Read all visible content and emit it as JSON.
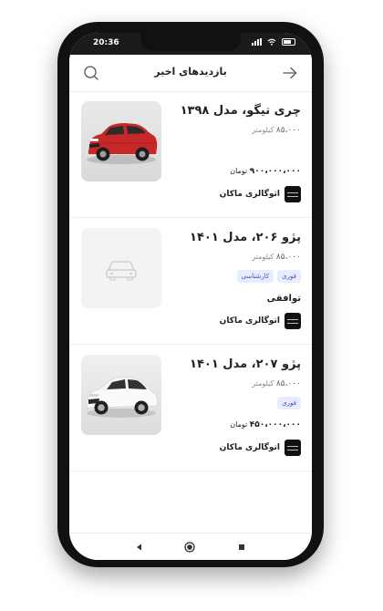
{
  "status_bar": {
    "time": "20:36"
  },
  "header": {
    "title": "بازدیدهای اخیر"
  },
  "listings": [
    {
      "title": "چری تیگو، مدل ۱۳۹۸",
      "mileage": "۸۵،۰۰۰",
      "mileage_unit": "کیلومتر",
      "price": "۹۰۰،۰۰۰،۰۰۰",
      "price_unit": "تومان",
      "dealer": "اتوگالری ماکان",
      "image": "red-suv"
    },
    {
      "title": "پژو ۲۰۶، مدل ۱۴۰۱",
      "mileage": "۸۵،۰۰۰",
      "mileage_unit": "کیلومتر",
      "tags": [
        "فوری",
        "کارشناسی"
      ],
      "price_text": "توافقی",
      "dealer": "اتوگالری ماکان",
      "image": "car-placeholder-icon"
    },
    {
      "title": "پژو ۲۰۷، مدل ۱۴۰۱",
      "mileage": "۸۵،۰۰۰",
      "mileage_unit": "کیلومتر",
      "tags": [
        "فوری"
      ],
      "price": "۴۵۰،۰۰۰،۰۰۰",
      "price_unit": "تومان",
      "dealer": "اتوگالری ماکان",
      "image": "white-hatchback"
    }
  ],
  "icons": {
    "search": "search-icon",
    "back": "arrow-right-icon",
    "nav_back": "triangle-back-icon",
    "nav_home": "circle-home-icon",
    "nav_recents": "square-recents-icon"
  },
  "colors": {
    "badge_text": "#3f51b5",
    "badge_bg": "#e9ecff",
    "car_red": "#c62828"
  }
}
